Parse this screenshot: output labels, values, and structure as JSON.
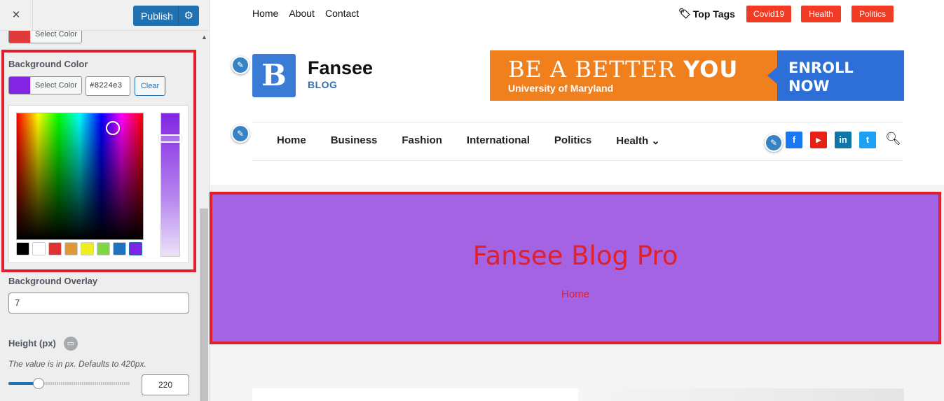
{
  "sidebar": {
    "close_icon": "×",
    "publish_label": "Publish",
    "top_color_button": {
      "label": "Select Color",
      "color": "#e03a3a"
    },
    "background_color": {
      "label": "Background Color",
      "select_label": "Select Color",
      "hex_value": "#8224e3",
      "clear_label": "Clear",
      "swatch_color": "#8224e3",
      "palette": [
        "#000000",
        "#ffffff",
        "#dd3333",
        "#dd9933",
        "#eeee22",
        "#81d742",
        "#1e73be",
        "#8224e3"
      ]
    },
    "overlay": {
      "label": "Background Overlay",
      "value": "7"
    },
    "height": {
      "label": "Height (px)",
      "description": "The value is in px. Defaults to 420px.",
      "value": "220",
      "slider_fraction": 0.25
    }
  },
  "preview": {
    "topnav": [
      "Home",
      "About",
      "Contact"
    ],
    "top_tags_label": "Top Tags",
    "tags": [
      "Covid19",
      "Health",
      "Politics"
    ],
    "logo": {
      "letter": "B",
      "title": "Fansee",
      "subtitle": "BLOG",
      "color": "#3a7bd5"
    },
    "ad": {
      "headline_light": "BE A BETTER",
      "headline_bold": "YOU",
      "sub": "University of Maryland",
      "cta_line1": "ENROLL",
      "cta_line2": "NOW"
    },
    "mainnav": [
      "Home",
      "Business",
      "Fashion",
      "International",
      "Politics",
      "Health"
    ],
    "social": [
      {
        "name": "facebook",
        "glyph": "f",
        "color": "#1877f2"
      },
      {
        "name": "youtube",
        "glyph": "▶",
        "color": "#e62117"
      },
      {
        "name": "linkedin",
        "glyph": "in",
        "color": "#0e76a8"
      },
      {
        "name": "twitter",
        "glyph": "t",
        "color": "#1da1f2"
      }
    ],
    "banner": {
      "title": "Fansee Blog Pro",
      "breadcrumb": "Home",
      "background": "#a463e3",
      "text_color": "#e0202b"
    }
  }
}
